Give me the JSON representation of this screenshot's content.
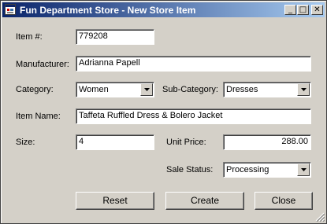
{
  "window": {
    "title": "Fun Department Store - New Store Item",
    "controls": {
      "minimize": "_",
      "maximize": "□",
      "close": "✕"
    },
    "icon": "app-form-icon"
  },
  "form": {
    "item_number": {
      "label": "Item #:",
      "value": "779208"
    },
    "manufacturer": {
      "label": "Manufacturer:",
      "value": "Adrianna Papell"
    },
    "category": {
      "label": "Category:",
      "value": "Women"
    },
    "sub_category": {
      "label": "Sub-Category:",
      "value": "Dresses"
    },
    "item_name": {
      "label": "Item Name:",
      "value": "Taffeta Ruffled Dress & Bolero Jacket"
    },
    "size": {
      "label": "Size:",
      "value": "4"
    },
    "unit_price": {
      "label": "Unit Price:",
      "value": "288.00"
    },
    "sale_status": {
      "label": "Sale Status:",
      "value": "Processing"
    }
  },
  "buttons": {
    "reset": "Reset",
    "create": "Create",
    "close": "Close"
  },
  "colors": {
    "titlebar_start": "#0a246a",
    "titlebar_end": "#a6caf0",
    "face": "#d4d0c8"
  }
}
